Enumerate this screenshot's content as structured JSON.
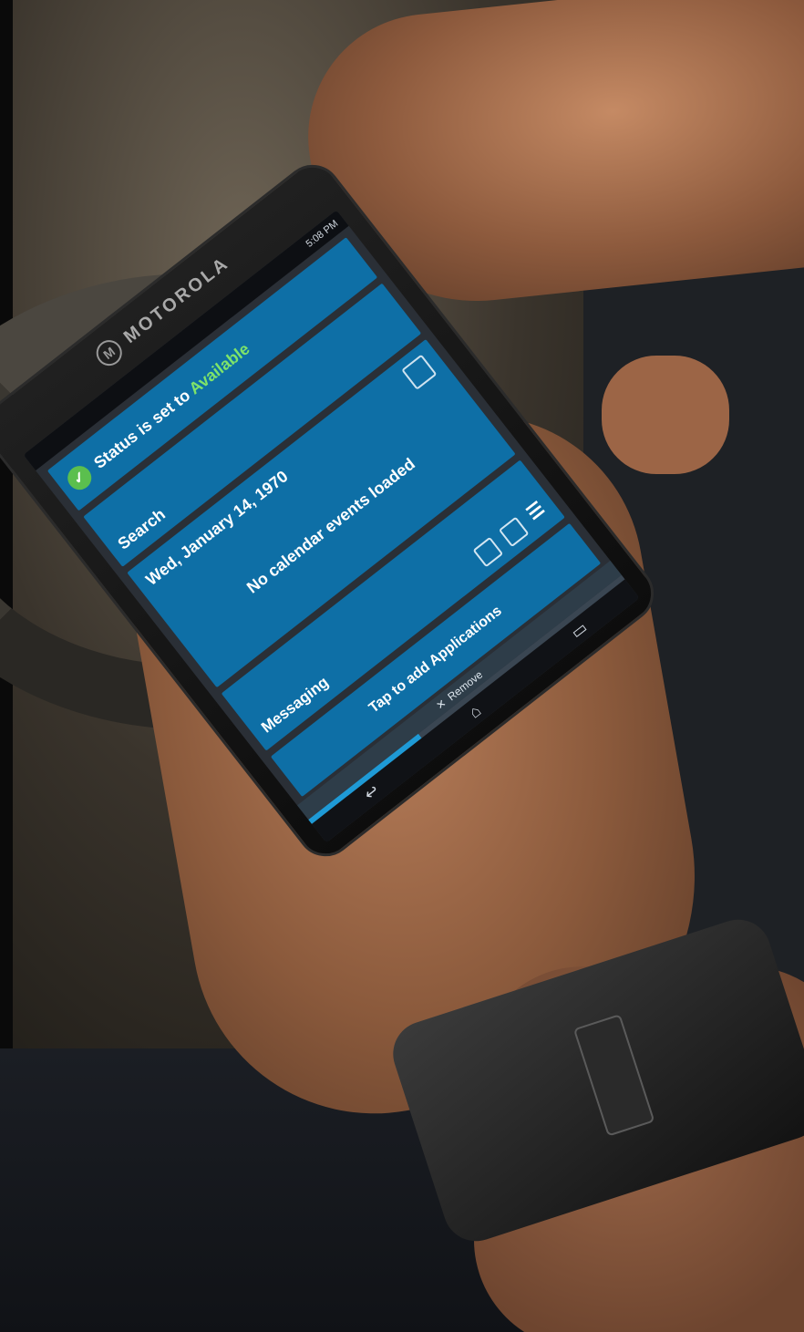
{
  "phone": {
    "brand": "MOTOROLA",
    "brand_logo": "M",
    "status_time": "5:08 PM",
    "status_tile": {
      "prefix": "Status is set to",
      "value": "Available"
    },
    "search_label": "Search",
    "calendar": {
      "date": "Wed, January 14, 1970",
      "message": "No calendar events loaded"
    },
    "messaging_label": "Messaging",
    "apps_label": "Tap to add Applications",
    "remove_label": "Remove",
    "progress_fraction": 0.35,
    "icons": [
      "check-icon",
      "calendar-icon",
      "mail-icon",
      "list-icon",
      "close-icon",
      "back-icon",
      "home-icon",
      "recent-apps-icon"
    ]
  },
  "colors": {
    "tile_blue": "#0e6fa6",
    "available_green": "#7ee36a",
    "check_green": "#5bbf4e"
  }
}
